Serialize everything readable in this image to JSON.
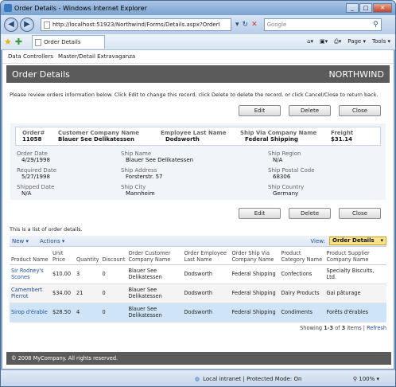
{
  "window": {
    "title": "Order Details - Windows Internet Explorer"
  },
  "nav": {
    "address": "http://localhost:51923/Northwind/Forms/Details.aspx?OrderI",
    "search_placeholder": "Google"
  },
  "tab": {
    "label": "Order Details"
  },
  "tools": {
    "page": "Page",
    "tools": "Tools"
  },
  "menu": {
    "items": [
      "Data Controllers",
      "Master/Detail Extravaganza"
    ]
  },
  "header": {
    "title": "Order Details",
    "brand": "NORTHWIND"
  },
  "description": "Please review orders information below. Click Edit to change this record, click Delete to delete the record, or click Cancel/Close to return back.",
  "buttons": {
    "edit": "Edit",
    "delete": "Delete",
    "close": "Close"
  },
  "summary": [
    {
      "label": "Order#",
      "value": "11058"
    },
    {
      "label": "Customer Company Name",
      "value": "Blauer See Delikatessen"
    },
    {
      "label": "Employee Last Name",
      "value": "Dodsworth"
    },
    {
      "label": "Ship Via Company Name",
      "value": "Federal Shipping"
    },
    {
      "label": "Freight",
      "value": "$31.14"
    }
  ],
  "fields": [
    {
      "label": "Order Date",
      "value": "4/29/1998"
    },
    {
      "label": "Ship Name",
      "value": "Blauer See Delikatessen"
    },
    {
      "label": "Ship Region",
      "value": "N/A"
    },
    {
      "label": "Required Date",
      "value": "5/27/1998"
    },
    {
      "label": "Ship Address",
      "value": "Forsterstr. 57"
    },
    {
      "label": "Ship Postal Code",
      "value": "68306"
    },
    {
      "label": "Shipped Date",
      "value": "N/A"
    },
    {
      "label": "Ship City",
      "value": "Mannheim"
    },
    {
      "label": "Ship Country",
      "value": "Germany"
    }
  ],
  "list_caption": "This is a list of order details.",
  "grid_toolbar": {
    "new": "New",
    "actions": "Actions",
    "view_label": "View:",
    "view_value": "Order Details"
  },
  "columns": [
    "Product Name",
    "Unit Price",
    "Quantity",
    "Discount",
    "Order Customer Company Name",
    "Order Employee Last Name",
    "Order Ship Via Company Name",
    "Product Category Name",
    "Product Supplier Company Name"
  ],
  "rows": [
    [
      "Sir Rodney's Scones",
      "$10.00",
      "3",
      "0",
      "Blauer See Delikatessen",
      "Dodsworth",
      "Federal Shipping",
      "Confections",
      "Specialty Biscuits, Ltd."
    ],
    [
      "Camembert Pierrot",
      "$34.00",
      "21",
      "0",
      "Blauer See Delikatessen",
      "Dodsworth",
      "Federal Shipping",
      "Dairy Products",
      "Gai pâturage"
    ],
    [
      "Sirop d'érable",
      "$28.50",
      "4",
      "0",
      "Blauer See Delikatessen",
      "Dodsworth",
      "Federal Shipping",
      "Condiments",
      "Forêts d'érables"
    ]
  ],
  "pager": {
    "text_before": "Showing ",
    "range": "1-3",
    "text_mid": " of ",
    "total": "3",
    "text_after": " items | ",
    "refresh": "Refresh"
  },
  "footer": "© 2008 MyCompany. All rights reserved.",
  "status": {
    "zone": "Local intranet | Protected Mode: On",
    "zoom": "100%"
  }
}
